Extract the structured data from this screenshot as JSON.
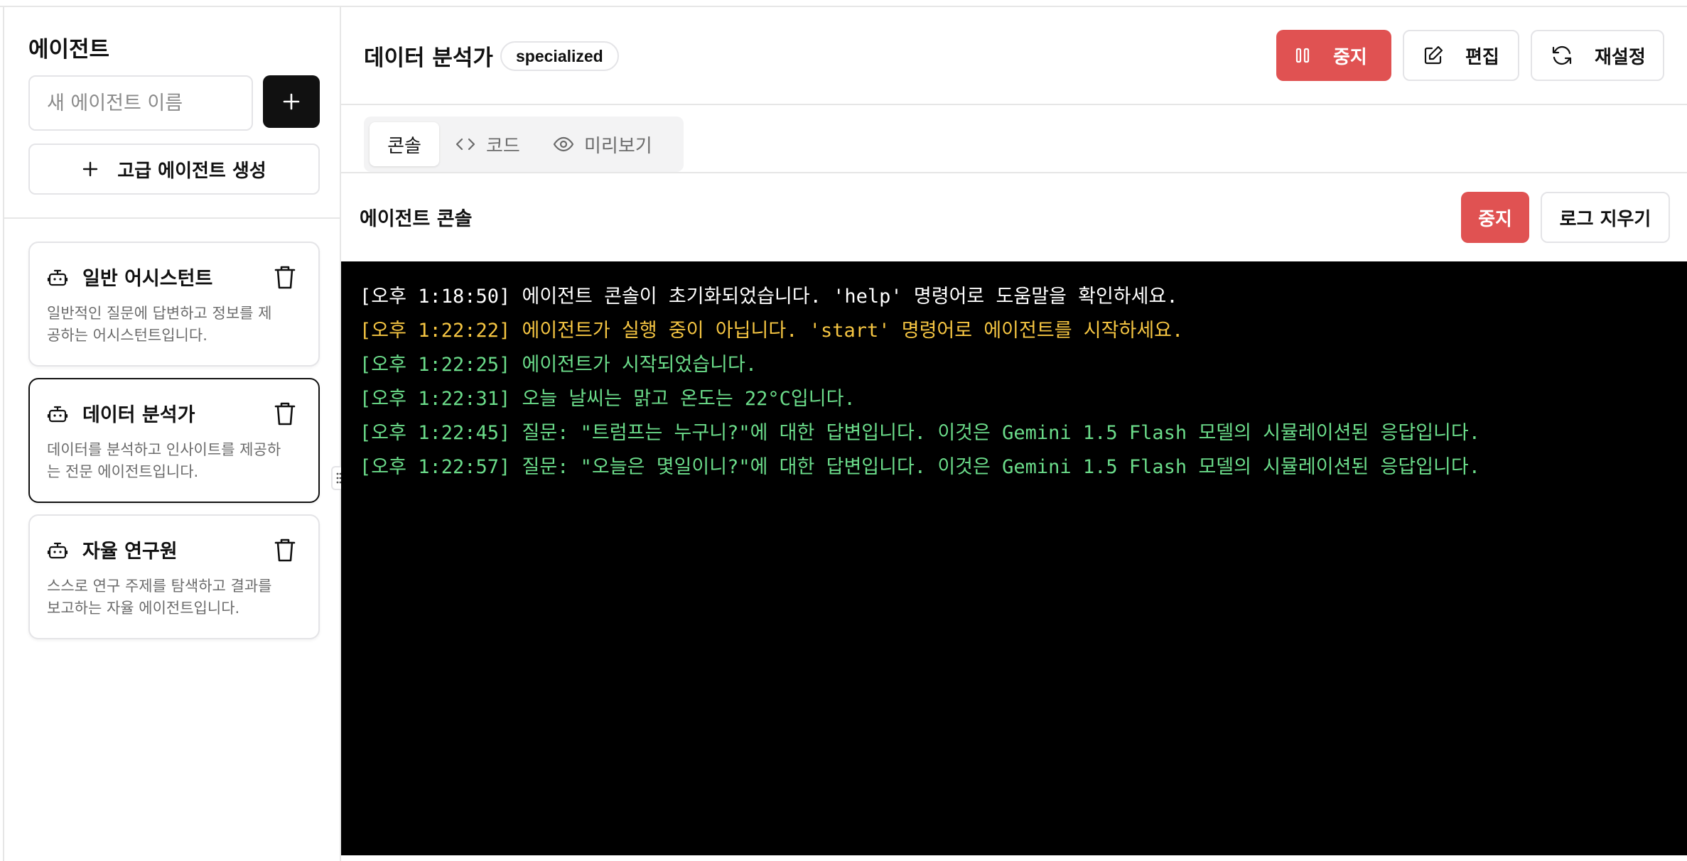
{
  "sidebar": {
    "title": "에이전트",
    "new_agent_placeholder": "새 에이전트 이름",
    "advanced_create_label": "고급 에이전트 생성",
    "agents": [
      {
        "name": "일반 어시스턴트",
        "desc_line1": "일반적인 질문에 답변하고 정보를 제",
        "desc_line2": "공하는 어시스턴트입니다.",
        "selected": false
      },
      {
        "name": "데이터 분석가",
        "desc_line1": "데이터를 분석하고 인사이트를 제공하",
        "desc_line2": "는 전문 에이전트입니다.",
        "selected": true
      },
      {
        "name": "자율 연구원",
        "desc_line1": "스스로 연구 주제를 탐색하고 결과를",
        "desc_line2": "보고하는 자율 에이전트입니다.",
        "selected": false
      }
    ]
  },
  "header": {
    "title": "데이터 분석가",
    "badge": "specialized",
    "stop_label": "중지",
    "edit_label": "편집",
    "reset_label": "재설정"
  },
  "tabs": [
    {
      "label": "콘솔",
      "icon": "none",
      "active": true
    },
    {
      "label": "코드",
      "icon": "code-icon",
      "active": false
    },
    {
      "label": "미리보기",
      "icon": "eye-icon",
      "active": false
    }
  ],
  "console": {
    "title": "에이전트 콘솔",
    "stop_label": "중지",
    "clear_label": "로그 지우기",
    "lines": [
      {
        "text": "[오후 1:18:50] 에이전트 콘솔이 초기화되었습니다. 'help' 명령어로 도움말을 확인하세요.",
        "color": "#ffffff"
      },
      {
        "text": "[오후 1:22:22] 에이전트가 실행 중이 아닙니다. 'start' 명령어로 에이전트를 시작하세요.",
        "color": "#f5c542"
      },
      {
        "text": "[오후 1:22:25] 에이전트가 시작되었습니다.",
        "color": "#6bdc8a"
      },
      {
        "text": "[오후 1:22:31] 오늘 날씨는 맑고 온도는 22°C입니다.",
        "color": "#6bdc8a"
      },
      {
        "text": "[오후 1:22:45] 질문: \"트럼프는 누구니?\"에 대한 답변입니다. 이것은 Gemini 1.5 Flash 모델의 시뮬레이션된 응답입니다.",
        "color": "#6bdc8a"
      },
      {
        "text": "[오후 1:22:57] 질문: \"오늘은 몇일이니?\"에 대한 답변입니다. 이것은 Gemini 1.5 Flash 모델의 시뮬레이션된 응답입니다.",
        "color": "#6bdc8a"
      }
    ]
  },
  "colors": {
    "danger": "#e05252",
    "primary_dark": "#111111",
    "border": "#e4e4e7",
    "console_bg": "#000000"
  }
}
